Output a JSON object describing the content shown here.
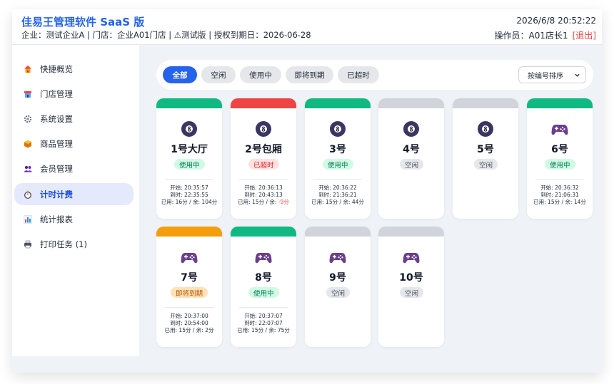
{
  "header": {
    "app_title": "佳易王管理软件 SaaS 版",
    "subinfo": "企业：测试企业A | 门店：企业A01门店 | ⚠测试版 | 授权到期日：2026-06-28",
    "datetime": "2026/6/8 20:52:22",
    "operator_label": "操作员：A01店长1",
    "logout_label": "[退出]"
  },
  "sidebar": {
    "items": [
      {
        "label": "快捷概览",
        "icon": "home-icon"
      },
      {
        "label": "门店管理",
        "icon": "store-icon"
      },
      {
        "label": "系统设置",
        "icon": "gear-icon"
      },
      {
        "label": "商品管理",
        "icon": "box-icon"
      },
      {
        "label": "会员管理",
        "icon": "members-icon"
      },
      {
        "label": "计时计费",
        "icon": "stopwatch-icon",
        "active": true
      },
      {
        "label": "统计报表",
        "icon": "bar-chart-icon"
      },
      {
        "label": "打印任务 (1)",
        "icon": "printer-icon"
      }
    ]
  },
  "filters": {
    "chips": [
      "全部",
      "空闲",
      "使用中",
      "即将到期",
      "已超时"
    ],
    "active": "全部",
    "sort_label": "按编号排序"
  },
  "colors": {
    "brand": "#2563eb",
    "in_use": "#10b981",
    "overtime": "#ef4444",
    "expiring": "#f59e0b",
    "idle": "#d1d5db"
  },
  "cards": [
    {
      "name": "1号大厅",
      "icon": "billiard-ball-icon",
      "status": "使用中",
      "status_key": "in_use",
      "start": "开始: 20:35:57",
      "end": "到时: 22:35:55",
      "used": "已用: 16分 / 余: ",
      "remain": "104分",
      "remain_negative": false
    },
    {
      "name": "2号包厢",
      "icon": "billiard-ball-icon",
      "status": "已超时",
      "status_key": "overtime",
      "start": "开始: 20:36:13",
      "end": "到时: 20:43:13",
      "used": "已用: 15分 / 余: ",
      "remain": "-9分",
      "remain_negative": true
    },
    {
      "name": "3号",
      "icon": "billiard-ball-icon",
      "status": "使用中",
      "status_key": "in_use",
      "start": "开始: 20:36:22",
      "end": "到时: 21:36:21",
      "used": "已用: 15分 / 余: ",
      "remain": "44分",
      "remain_negative": false
    },
    {
      "name": "4号",
      "icon": "billiard-ball-icon",
      "status": "空闲",
      "status_key": "idle"
    },
    {
      "name": "5号",
      "icon": "billiard-ball-icon",
      "status": "空闲",
      "status_key": "idle"
    },
    {
      "name": "6号",
      "icon": "gamepad-icon",
      "status": "使用中",
      "status_key": "in_use",
      "start": "开始: 20:36:32",
      "end": "到时: 21:06:31",
      "used": "已用: 15分 / 余: ",
      "remain": "14分",
      "remain_negative": false
    },
    {
      "name": "7号",
      "icon": "gamepad-icon",
      "status": "即将到期",
      "status_key": "expiring",
      "start": "开始: 20:37:00",
      "end": "到时: 20:54:00",
      "used": "已用: 15分 / 余: ",
      "remain": "2分",
      "remain_negative": false
    },
    {
      "name": "8号",
      "icon": "gamepad-icon",
      "status": "使用中",
      "status_key": "in_use",
      "start": "开始: 20:37:07",
      "end": "到时: 22:07:07",
      "used": "已用: 15分 / 余: ",
      "remain": "75分",
      "remain_negative": false
    },
    {
      "name": "9号",
      "icon": "gamepad-icon",
      "status": "空闲",
      "status_key": "idle"
    },
    {
      "name": "10号",
      "icon": "gamepad-icon",
      "status": "空闲",
      "status_key": "idle"
    }
  ]
}
